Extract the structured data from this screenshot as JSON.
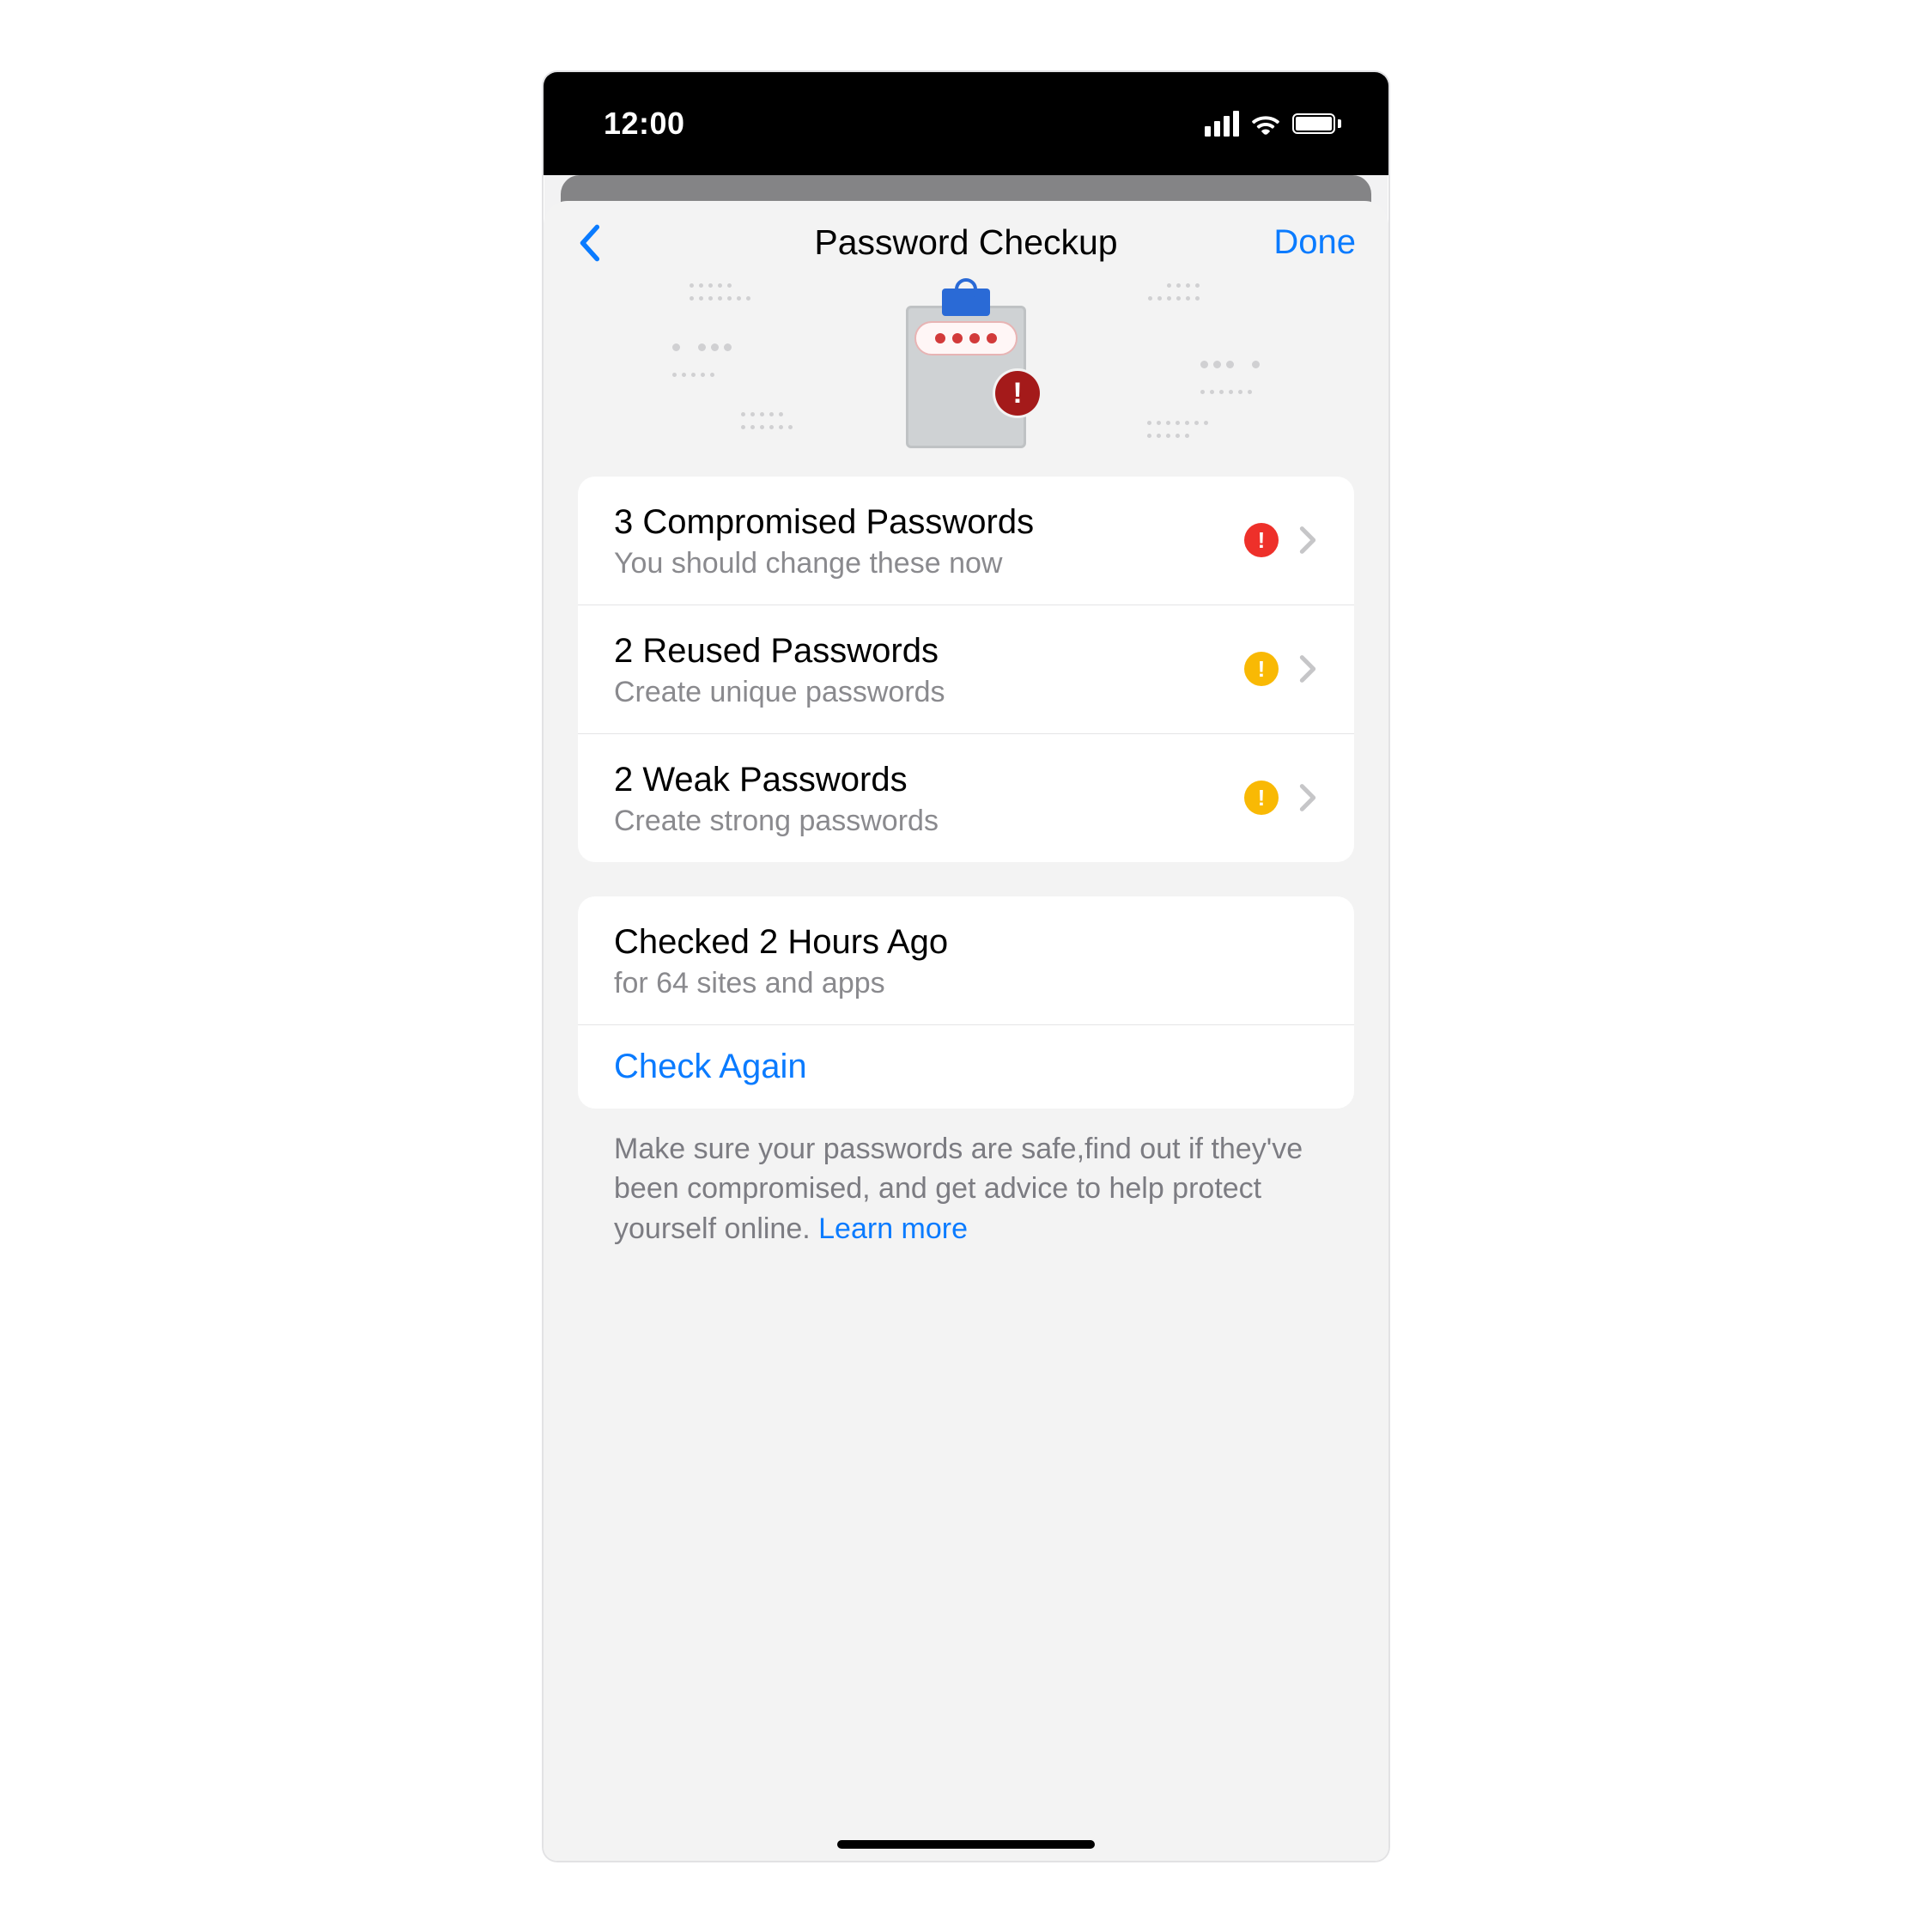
{
  "statusbar": {
    "time": "12:00"
  },
  "nav": {
    "title": "Password Checkup",
    "done": "Done"
  },
  "colors": {
    "link": "#0a7bff",
    "red": "#ee302a",
    "yellow": "#f9b904"
  },
  "results": [
    {
      "title": "3 Compromised Passwords",
      "subtitle": "You should change these now",
      "severity": "red"
    },
    {
      "title": "2 Reused Passwords",
      "subtitle": "Create unique passwords",
      "severity": "yellow"
    },
    {
      "title": "2 Weak Passwords",
      "subtitle": "Create strong passwords",
      "severity": "yellow"
    }
  ],
  "last_check": {
    "title": "Checked 2 Hours Ago",
    "subtitle": "for 64 sites and apps",
    "action": "Check Again"
  },
  "footer": {
    "text": "Make sure your passwords are safe,find out if they've been compromised, and get advice to help protect yourself online. ",
    "learn_more": "Learn more"
  }
}
